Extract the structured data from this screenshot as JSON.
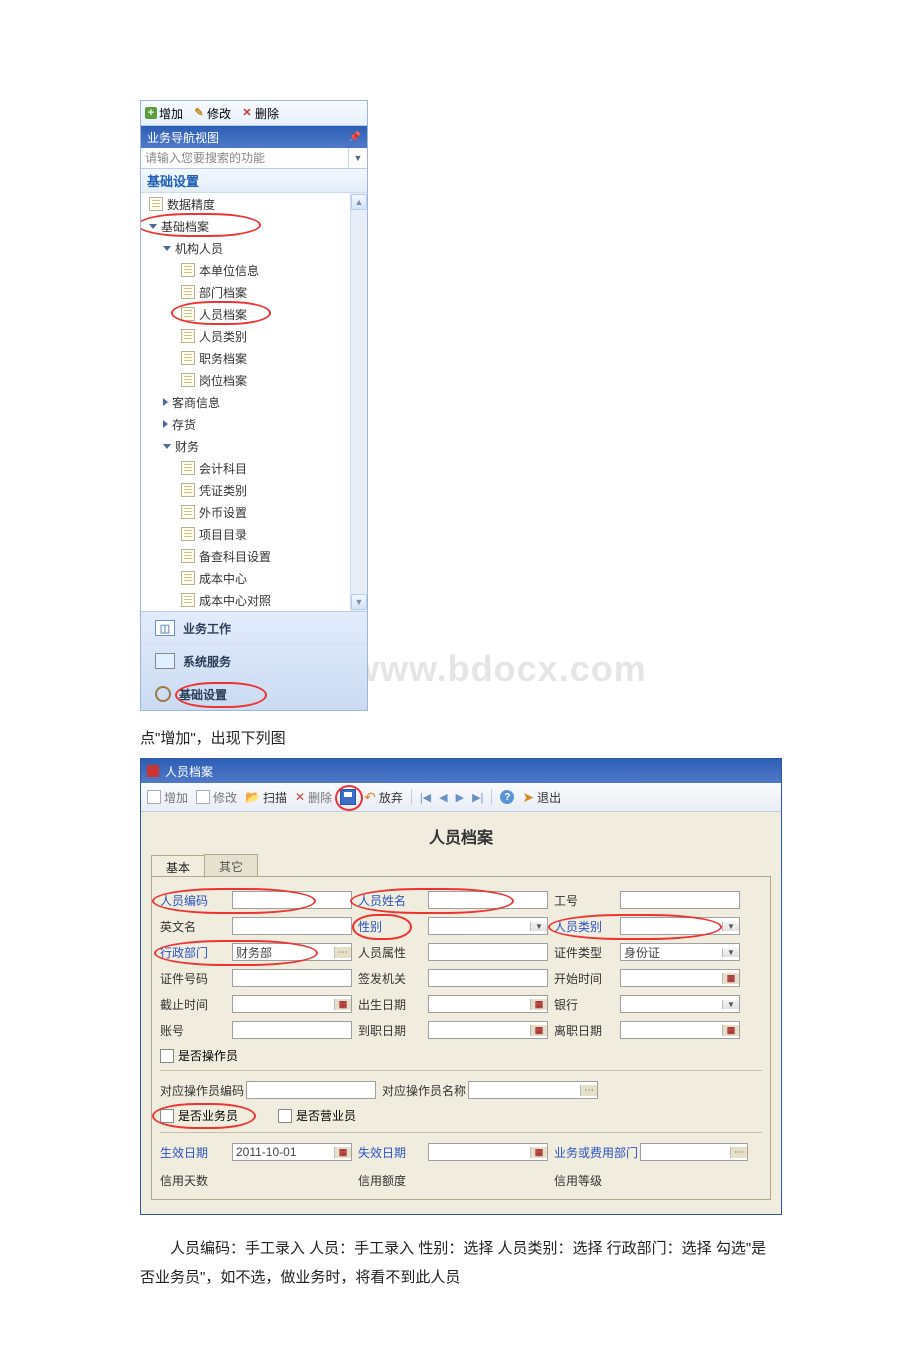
{
  "shot1": {
    "toolbar": {
      "add": "增加",
      "modify": "修改",
      "delete": "删除"
    },
    "navTitle": "业务导航视图",
    "searchPlaceholder": "请输入您要搜索的功能",
    "sectionTitle": "基础设置",
    "tree": {
      "dataPrecision": "数据精度",
      "basicArchive": "基础档案",
      "orgPersonnel": "机构人员",
      "companyInfo": "本单位信息",
      "deptArchive": "部门档案",
      "personArchive": "人员档案",
      "personType": "人员类别",
      "jobArchive": "职务档案",
      "postArchive": "岗位档案",
      "vendorInfo": "客商信息",
      "inventory": "存货",
      "finance": "财务",
      "accountSubject": "会计科目",
      "voucherType": "凭证类别",
      "foreignCurrency": "外币设置",
      "projectCatalog": "项目目录",
      "auditSubject": "备查科目设置",
      "costCenter": "成本中心",
      "costCenterMap": "成本中心对照"
    },
    "bottom": {
      "bizWork": "业务工作",
      "sysService": "系统服务",
      "basicSetting": "基础设置"
    }
  },
  "captions": {
    "afterShot1": "点\"增加\"，出现下列图",
    "afterShot2": "人员编码：手工录入 人员：手工录入 性别：选择 人员类别：选择 行政部门：选择 勾选\"是否业务员\"，如不选，做业务时，将看不到此人员"
  },
  "watermark": "www.bdocx.com",
  "shot2": {
    "windowTitle": "人员档案",
    "toolbar": {
      "add": "增加",
      "modify": "修改",
      "scan": "扫描",
      "delete": "删除",
      "discard": "放弃",
      "exit": "退出"
    },
    "heading": "人员档案",
    "tabs": {
      "basic": "基本",
      "other": "其它"
    },
    "labels": {
      "personCode": "人员编码",
      "personName": "人员姓名",
      "workNo": "工号",
      "englishName": "英文名",
      "gender": "性别",
      "personType": "人员类别",
      "adminDept": "行政部门",
      "personAttr": "人员属性",
      "idType": "证件类型",
      "idNumber": "证件号码",
      "issueOrg": "签发机关",
      "startTime": "开始时间",
      "endTime": "截止时间",
      "birthDate": "出生日期",
      "bank": "银行",
      "account": "账号",
      "onboardDate": "到职日期",
      "leaveDate": "离职日期",
      "isOperator": "是否操作员",
      "opCode": "对应操作员编码",
      "opName": "对应操作员名称",
      "isSalesman": "是否业务员",
      "isClerk": "是否营业员",
      "effectiveDate": "生效日期",
      "expiryDate": "失效日期",
      "bizDept": "业务或费用部门",
      "creditDays": "信用天数",
      "creditLimit": "信用额度",
      "creditRank": "信用等级"
    },
    "values": {
      "adminDept": "财务部",
      "idType": "身份证",
      "effectiveDate": "2011-10-01"
    }
  }
}
